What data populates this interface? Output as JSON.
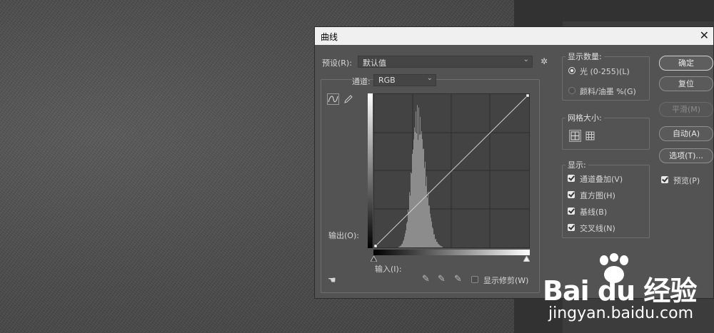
{
  "dialog": {
    "title": "曲线",
    "close": "✕",
    "preset": {
      "label": "预设(R):",
      "value": "默认值"
    },
    "channel": {
      "label": "通道:",
      "value": "RGB"
    },
    "output_label": "输出(O):",
    "input_label": "输入(I):",
    "show_clipping": {
      "label": "显示修剪(W)",
      "checked": false
    }
  },
  "display_amount": {
    "title": "显示数量:",
    "options": [
      {
        "label": "光 (0-255)(L)",
        "selected": true
      },
      {
        "label": "颜料/油墨 %(G)",
        "selected": false
      }
    ]
  },
  "grid_size": {
    "title": "网格大小:"
  },
  "show": {
    "title": "显示:",
    "items": [
      {
        "label": "通道叠加(V)",
        "checked": true
      },
      {
        "label": "直方图(H)",
        "checked": true
      },
      {
        "label": "基线(B)",
        "checked": true
      },
      {
        "label": "交叉线(N)",
        "checked": true
      }
    ]
  },
  "buttons": {
    "ok": "确定",
    "reset": "复位",
    "smooth": "平滑(M)",
    "auto": "自动(A)",
    "options": "选项(T)..."
  },
  "preview": {
    "label": "预览(P)",
    "checked": true
  },
  "watermark": {
    "brand": "Bai du 经验",
    "url": "jingyan.baidu.com"
  }
}
